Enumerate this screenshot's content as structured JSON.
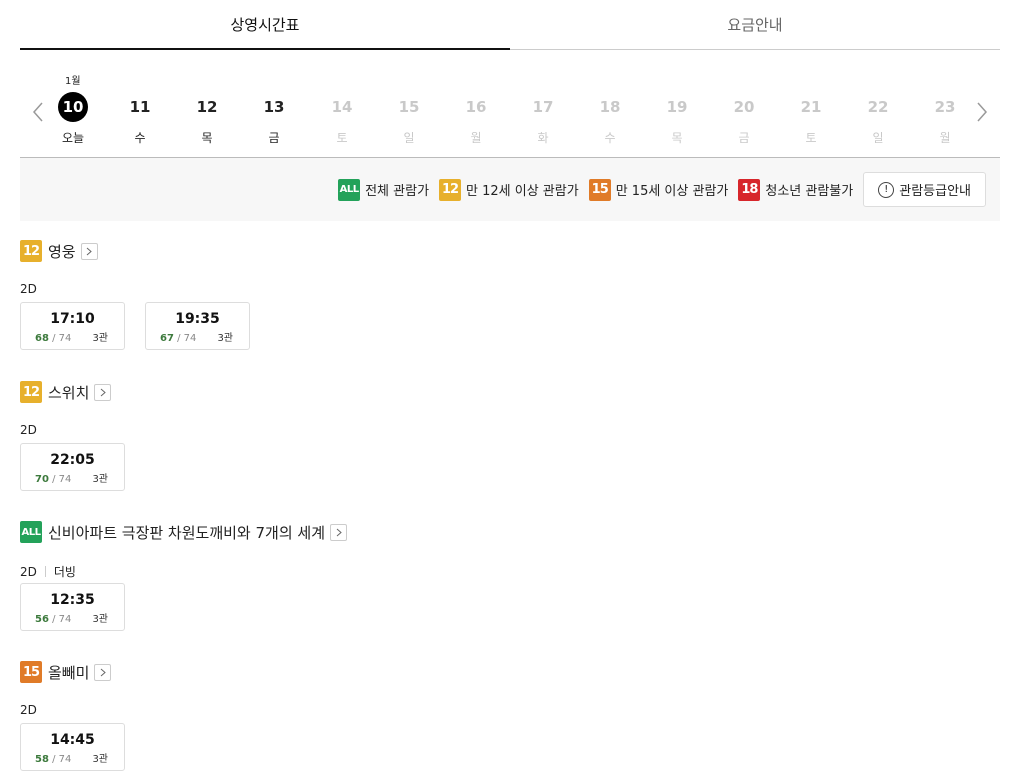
{
  "tabs": [
    {
      "label": "상영시간표",
      "active": true
    },
    {
      "label": "요금안내",
      "active": false
    }
  ],
  "dates": {
    "month_label": "1월",
    "days": [
      {
        "num": "10",
        "dow": "오늘",
        "state": "today"
      },
      {
        "num": "11",
        "dow": "수",
        "state": "on"
      },
      {
        "num": "12",
        "dow": "목",
        "state": "on"
      },
      {
        "num": "13",
        "dow": "금",
        "state": "on"
      },
      {
        "num": "14",
        "dow": "토",
        "state": "off"
      },
      {
        "num": "15",
        "dow": "일",
        "state": "off"
      },
      {
        "num": "16",
        "dow": "월",
        "state": "off"
      },
      {
        "num": "17",
        "dow": "화",
        "state": "off"
      },
      {
        "num": "18",
        "dow": "수",
        "state": "off"
      },
      {
        "num": "19",
        "dow": "목",
        "state": "off"
      },
      {
        "num": "20",
        "dow": "금",
        "state": "off"
      },
      {
        "num": "21",
        "dow": "토",
        "state": "off"
      },
      {
        "num": "22",
        "dow": "일",
        "state": "off"
      },
      {
        "num": "23",
        "dow": "월",
        "state": "off"
      }
    ]
  },
  "legend": {
    "items": [
      {
        "badge": "ALL",
        "cls": "b-all",
        "label": "전체 관람가"
      },
      {
        "badge": "12",
        "cls": "b-12",
        "label": "만 12세 이상 관람가"
      },
      {
        "badge": "15",
        "cls": "b-15",
        "label": "만 15세 이상 관람가"
      },
      {
        "badge": "18",
        "cls": "b-18",
        "label": "청소년 관람불가"
      }
    ],
    "info_button": "관람등급안내"
  },
  "movies": [
    {
      "badge": "12",
      "cls": "b-12",
      "title": "영웅",
      "format": "2D",
      "dub": "",
      "times": [
        {
          "time": "17:10",
          "avail": "68",
          "total": "/ 74",
          "hall": "3관"
        },
        {
          "time": "19:35",
          "avail": "67",
          "total": "/ 74",
          "hall": "3관"
        }
      ]
    },
    {
      "badge": "12",
      "cls": "b-12",
      "title": "스위치",
      "format": "2D",
      "dub": "",
      "times": [
        {
          "time": "22:05",
          "avail": "70",
          "total": "/ 74",
          "hall": "3관"
        }
      ]
    },
    {
      "badge": "ALL",
      "cls": "b-all",
      "title": "신비아파트 극장판 차원도깨비와 7개의 세계",
      "format": "2D",
      "dub": "더빙",
      "times": [
        {
          "time": "12:35",
          "avail": "56",
          "total": "/ 74",
          "hall": "3관"
        }
      ]
    },
    {
      "badge": "15",
      "cls": "b-15",
      "title": "올빼미",
      "format": "2D",
      "dub": "",
      "times": [
        {
          "time": "14:45",
          "avail": "58",
          "total": "/ 74",
          "hall": "3관"
        }
      ]
    }
  ],
  "colors": {
    "all": "#23a25a",
    "r12": "#e7b02c",
    "r15": "#e07b28",
    "r18": "#d7262b",
    "seats_available": "#3d7a3d"
  }
}
